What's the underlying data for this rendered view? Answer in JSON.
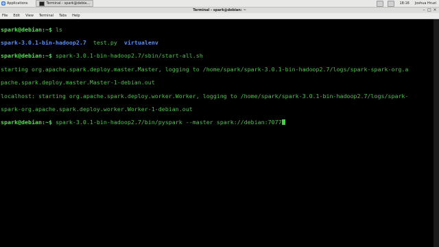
{
  "panel": {
    "applications_label": "Applications",
    "task_label": "Terminal - spark@debia...",
    "clock": "18:16",
    "user": "Joshua Hruzi"
  },
  "window": {
    "title": "Terminal - spark@debian: ~",
    "menu": [
      "File",
      "Edit",
      "View",
      "Terminal",
      "Tabs",
      "Help"
    ]
  },
  "terminal": {
    "prompt": "spark@debian",
    "prompt_suffix": ":~$ ",
    "cmd1": "ls",
    "ls_output": {
      "dir1": "spark-3.0.1-bin-hadoop2.7",
      "file1": "test.py",
      "dir2": "virtualenv"
    },
    "cmd2": "spark-3.0.1-bin-hadoop2.7/sbin/start-all.sh",
    "out1": "starting org.apache.spark.deploy.master.Master, logging to /home/spark/spark-3.0.1-bin-hadoop2.7/logs/spark-spark-org.a",
    "out2": "pache.spark.deploy.master.Master-1-debian.out",
    "out3": "localhost: starting org.apache.spark.deploy.worker.Worker, logging to /home/spark/spark-3.0.1-bin-hadoop2.7/logs/spark-",
    "out4": "spark-org.apache.spark.deploy.worker.Worker-1-debian.out",
    "cmd3": "spark-3.0.1-bin-hadoop2.7/bin/pyspark --master spark://debian:7077"
  },
  "colors": {
    "terminal_bg": "#000000",
    "terminal_fg": "#4ec04e",
    "directory": "#5c8ef2"
  }
}
